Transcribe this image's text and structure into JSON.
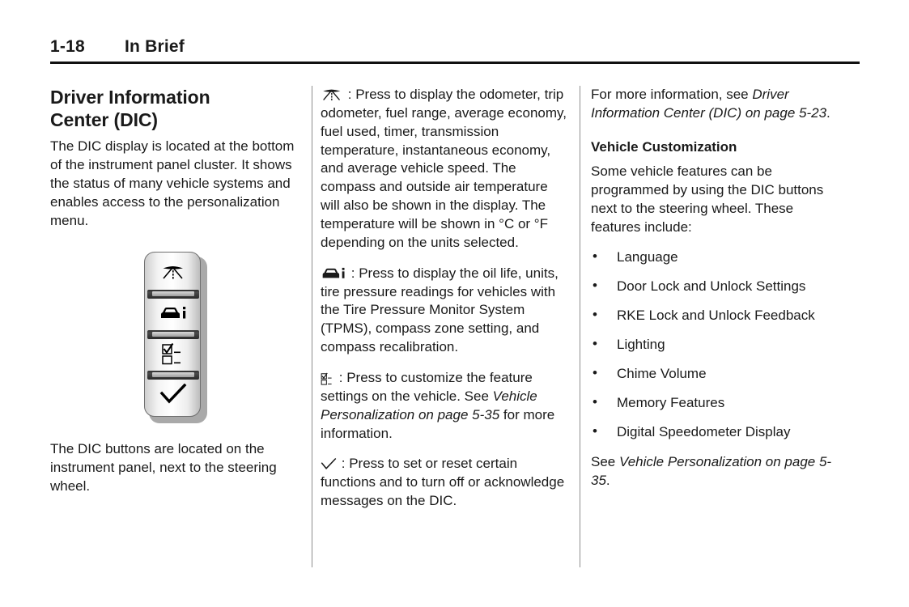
{
  "header": {
    "page_number": "1-18",
    "section": "In Brief"
  },
  "column_left": {
    "title_line1": "Driver Information",
    "title_line2": "Center (DIC)",
    "intro": "The DIC display is located at the bottom of the instrument panel cluster. It shows the status of many vehicle systems and enables access to the personalization menu.",
    "figure": {
      "name": "dic-button-panel",
      "buttons": [
        {
          "icon": "road-trip-icon",
          "label": "Trip / Fuel Information"
        },
        {
          "icon": "vehicle-info-icon",
          "label": "Vehicle Information"
        },
        {
          "icon": "customize-checklist-icon",
          "label": "Customization"
        },
        {
          "icon": "checkmark-icon",
          "label": "Set / Reset"
        }
      ]
    },
    "caption": "The DIC buttons are located on the instrument panel, next to the steering wheel."
  },
  "column_middle": {
    "entries": [
      {
        "icon": "road-trip-icon",
        "separator": ":",
        "text": "Press to display the odometer, trip odometer, fuel range, average economy, fuel used, timer, transmission temperature, instantaneous economy, and average vehicle speed. The compass and outside air temperature will also be shown in the display. The temperature will be shown in °C or °F depending on the units selected."
      },
      {
        "icon": "vehicle-info-icon",
        "separator": ":",
        "text": "Press to display the oil life, units, tire pressure readings for vehicles with the Tire Pressure Monitor System (TPMS), compass zone setting, and compass recalibration."
      },
      {
        "icon": "customize-checklist-icon",
        "separator": ":",
        "text_before": "Press to customize the feature settings on the vehicle. See ",
        "reference_italic": "Vehicle Personalization on page 5-35",
        "text_after": " for more information."
      },
      {
        "icon": "checkmark-icon",
        "separator": ":",
        "text": "Press to set or reset certain functions and to turn off or acknowledge messages on the DIC."
      }
    ]
  },
  "column_right": {
    "intro_before": "For more information, see ",
    "intro_italic": "Driver Information Center (DIC) on page 5-23",
    "intro_after": ".",
    "subsection_title": "Vehicle Customization",
    "subsection_intro": "Some vehicle features can be programmed by using the DIC buttons next to the steering wheel. These features include:",
    "features": [
      "Language",
      "Door Lock and Unlock Settings",
      "RKE Lock and Unlock Feedback",
      "Lighting",
      "Chime Volume",
      "Memory Features",
      "Digital Speedometer Display"
    ],
    "see_before": "See ",
    "see_italic": "Vehicle Personalization on page 5-35",
    "see_after": "."
  },
  "colors": {
    "text": "#1a1a1a",
    "rule": "#111111",
    "column_rule": "#8e8e8e",
    "background": "#ffffff"
  }
}
